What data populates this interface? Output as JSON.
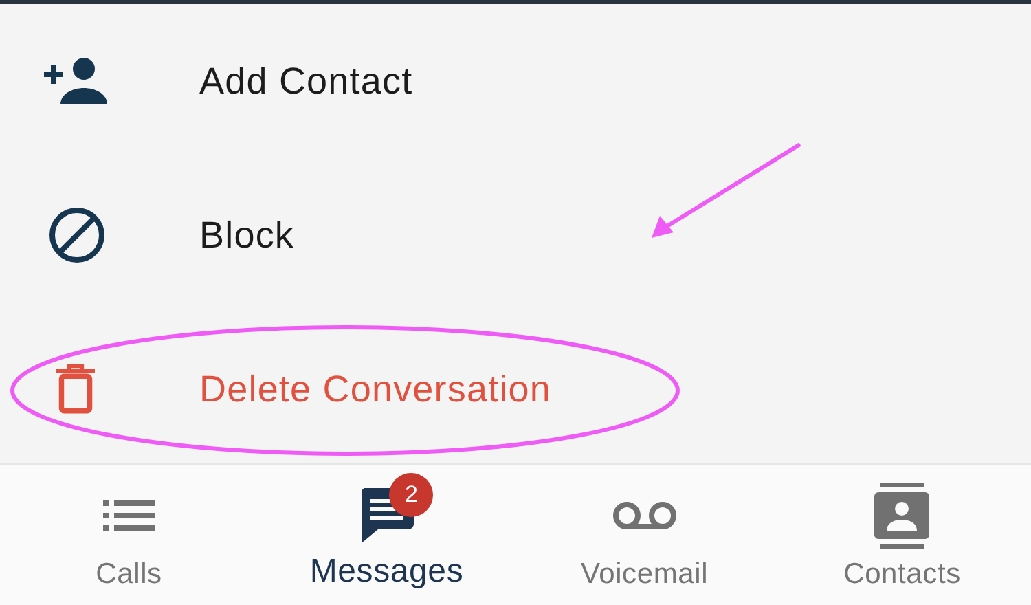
{
  "menu": {
    "items": [
      {
        "label": "Add Contact",
        "kind": "add",
        "annotated": false
      },
      {
        "label": "Block",
        "kind": "block",
        "annotated": false
      },
      {
        "label": "Delete Conversation",
        "kind": "delete",
        "annotated": true
      }
    ]
  },
  "tab_bar": {
    "tabs": [
      {
        "label": "Calls",
        "kind": "calls",
        "selected": false
      },
      {
        "label": "Messages",
        "kind": "messages",
        "selected": true,
        "badge": "2"
      },
      {
        "label": "Voicemail",
        "kind": "voicemail",
        "selected": false
      },
      {
        "label": "Contacts",
        "kind": "contacts",
        "selected": false
      }
    ]
  }
}
